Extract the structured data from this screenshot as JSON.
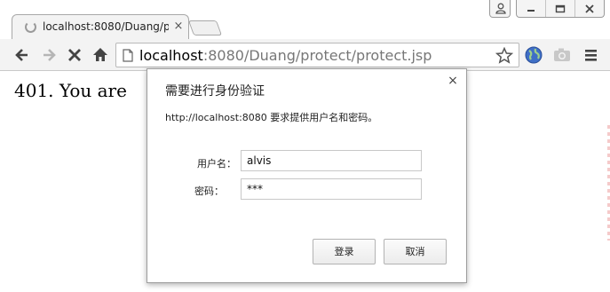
{
  "browser": {
    "tab": {
      "title": "localhost:8080/Duang/protect/protect.jsp",
      "close_glyph": "×",
      "loading": true
    },
    "omnibox": {
      "host": "localhost",
      "path": ":8080/Duang/protect/protect.jsp"
    },
    "icons": {
      "back": "back-arrow-icon",
      "forward": "forward-arrow-icon",
      "stop": "stop-icon",
      "home": "home-icon",
      "page": "page-icon",
      "star": "bookmark-star-icon",
      "globe": "globe-extension-icon",
      "camera": "camera-icon",
      "menu": "hamburger-menu-icon"
    }
  },
  "page": {
    "text": "401. You are"
  },
  "auth_dialog": {
    "title": "需要进行身份验证",
    "message": "http://localhost:8080 要求提供用户名和密码。",
    "close_glyph": "×",
    "username_label": "用户名：",
    "username_value": "alvis",
    "password_label": "密码：",
    "password_value": "***",
    "login_label": "登录",
    "cancel_label": "取消"
  },
  "colors": {
    "toolbar_bg": "#f3f3f3",
    "dialog_border": "#9d9d9d",
    "url_path": "#777777"
  }
}
